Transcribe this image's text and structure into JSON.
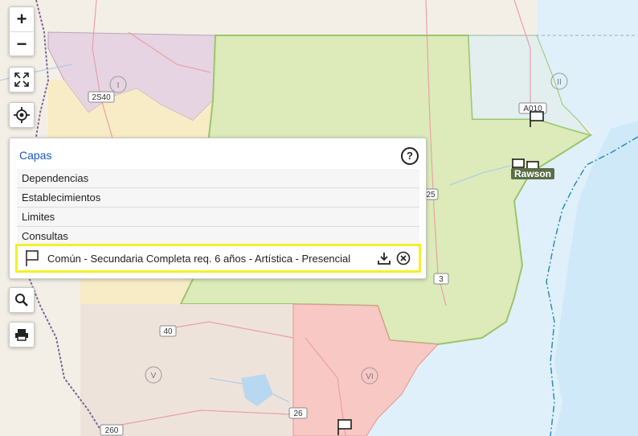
{
  "controls": {
    "zoom_in": "+",
    "zoom_out": "−",
    "fullscreen_icon": "expand-icon",
    "locate_icon": "crosshair-icon",
    "search_icon": "search-icon",
    "print_icon": "print-icon"
  },
  "layers_panel": {
    "title": "Capas",
    "help": "?",
    "items": [
      "Dependencias",
      "Establecimientos",
      "Limites",
      "Consultas"
    ],
    "active_layer": "Común - Secundaria Completa req. 6 años - Artística - Presencial"
  },
  "map": {
    "region_labels": [
      "I",
      "II",
      "V",
      "VI"
    ],
    "road_labels": [
      "2S40",
      "A010",
      "25",
      "3",
      "40",
      "26",
      "260"
    ],
    "city_label": "Rawson",
    "colors": {
      "ocean": "#dff0fb",
      "land": "#f4efe6",
      "region_I": "#e6d4e2",
      "region_II": "#e2efee",
      "region_center": "#dcebb9",
      "region_V": "#eee3db",
      "region_VI": "#f8c8c4",
      "region_west_yellow": "#f7ecc5",
      "highlight": "#f5f02a",
      "link": "#1a56c8"
    }
  }
}
